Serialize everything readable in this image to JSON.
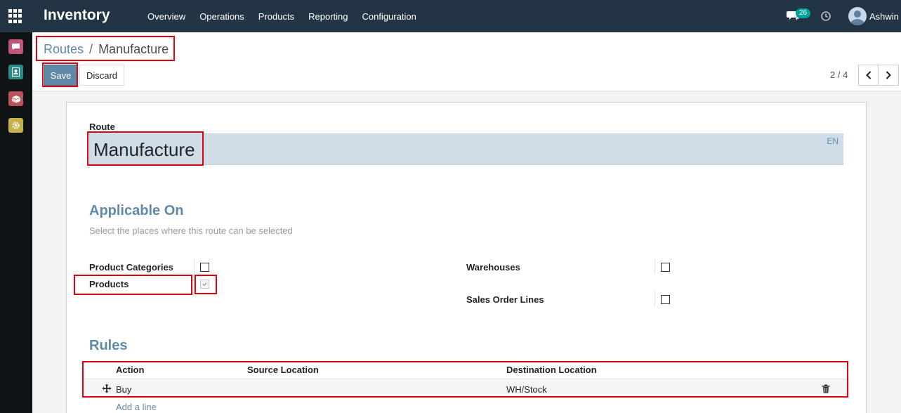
{
  "topbar": {
    "app_title": "Inventory",
    "menu": [
      "Overview",
      "Operations",
      "Products",
      "Reporting",
      "Configuration"
    ],
    "message_count": "26",
    "user_name": "Ashwin",
    "bg_color": "#233444"
  },
  "sidebar": {
    "icons": [
      "discuss-icon",
      "contacts-icon",
      "inventory-icon",
      "settings-icon"
    ]
  },
  "breadcrumb": {
    "parent": "Routes",
    "separator": "/",
    "current": "Manufacture"
  },
  "buttons": {
    "save": "Save",
    "discard": "Discard"
  },
  "pager": {
    "value": "2 / 4"
  },
  "form": {
    "route_label": "Route",
    "route_name": "Manufacture",
    "lang": "EN",
    "applicable_title": "Applicable On",
    "applicable_help": "Select the places where this route can be selected",
    "fields": {
      "product_categories": {
        "label": "Product Categories",
        "checked": false
      },
      "products": {
        "label": "Products",
        "checked": true
      },
      "warehouses": {
        "label": "Warehouses",
        "checked": false
      },
      "sales_order_lines": {
        "label": "Sales Order Lines",
        "checked": false
      }
    },
    "rules_title": "Rules",
    "rules_headers": [
      "Action",
      "Source Location",
      "Destination Location"
    ],
    "rules_rows": [
      {
        "action": "Buy",
        "source": "",
        "destination": "WH/Stock"
      }
    ],
    "add_line": "Add a line"
  },
  "colors": {
    "accent": "#5f8aa7",
    "highlight": "#e0000f"
  }
}
